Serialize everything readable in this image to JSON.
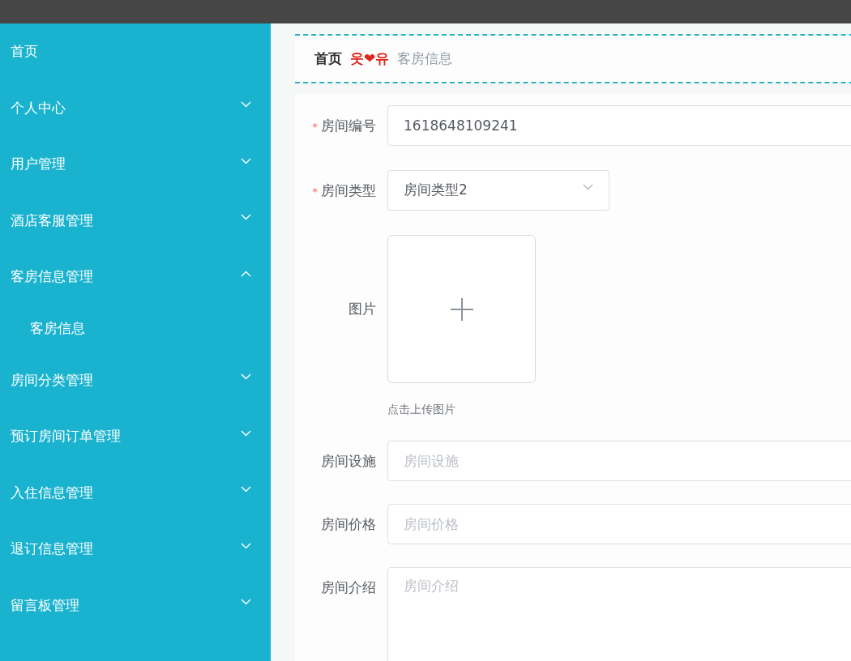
{
  "sidebar": {
    "items": [
      {
        "label": "首页",
        "kind": "link"
      },
      {
        "label": "个人中心",
        "kind": "menu",
        "expanded": false
      },
      {
        "label": "用户管理",
        "kind": "menu",
        "expanded": false
      },
      {
        "label": "酒店客服管理",
        "kind": "menu",
        "expanded": false
      },
      {
        "label": "客房信息管理",
        "kind": "menu",
        "expanded": true,
        "children": [
          {
            "label": "客房信息"
          }
        ]
      },
      {
        "label": "房间分类管理",
        "kind": "menu",
        "expanded": false
      },
      {
        "label": "预订房间订单管理",
        "kind": "menu",
        "expanded": false
      },
      {
        "label": "入住信息管理",
        "kind": "menu",
        "expanded": false
      },
      {
        "label": "退订信息管理",
        "kind": "menu",
        "expanded": false
      },
      {
        "label": "留言板管理",
        "kind": "menu",
        "expanded": false
      }
    ]
  },
  "breadcrumb": {
    "items": [
      "首页",
      "客房信息"
    ],
    "separator": "웃❤유"
  },
  "form": {
    "fields": [
      {
        "label": "房间编号",
        "required_mark": "*",
        "kind": "text",
        "value": "1618648109241"
      },
      {
        "label": "房间类型",
        "required_mark": "*",
        "kind": "select",
        "value": "房间类型2"
      },
      {
        "label": "图片",
        "kind": "upload",
        "hint": "点击上传图片"
      },
      {
        "label": "房间设施",
        "kind": "text",
        "placeholder": "房间设施"
      },
      {
        "label": "房间价格",
        "kind": "text",
        "placeholder": "房间价格"
      },
      {
        "label": "房间介绍",
        "kind": "textarea",
        "placeholder": "房间介绍"
      }
    ]
  }
}
